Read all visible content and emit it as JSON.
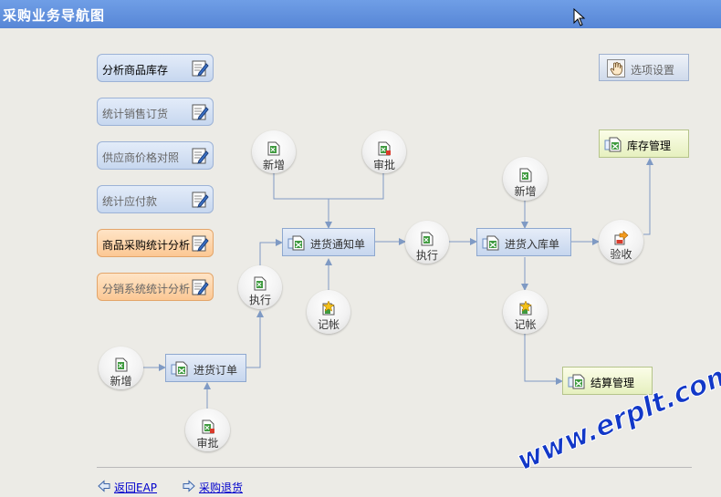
{
  "window": {
    "title": "采购业务导航图"
  },
  "sidebar": {
    "buttons": [
      {
        "label": "分析商品库存"
      },
      {
        "label": "统计销售订货"
      },
      {
        "label": "供应商价格对照"
      },
      {
        "label": "统计应付款"
      },
      {
        "label": "商品采购统计分析"
      },
      {
        "label": "分销系统统计分析"
      }
    ]
  },
  "options": {
    "label": "选项设置"
  },
  "flow": {
    "new_1": "新增",
    "approve_1": "审批",
    "order": "进货订单",
    "execute_1": "执行",
    "notice": "进货通知单",
    "new_2": "新增",
    "approve_2": "审批",
    "post_1": "记帐",
    "execute_2": "执行",
    "receipt": "进货入库单",
    "new_3": "新增",
    "post_2": "记帐",
    "inspect": "验收",
    "inventory": "库存管理",
    "settlement": "结算管理"
  },
  "footer": {
    "back": "返回EAP",
    "return_goods": "采购退货"
  },
  "watermark": {
    "text": "www.erplt.com"
  },
  "colors": {
    "titlebar": "#5786d6",
    "background": "#ecebe6",
    "connector": "#7f9ac4",
    "link": "#0000cc",
    "watermark": "#1238c8"
  }
}
